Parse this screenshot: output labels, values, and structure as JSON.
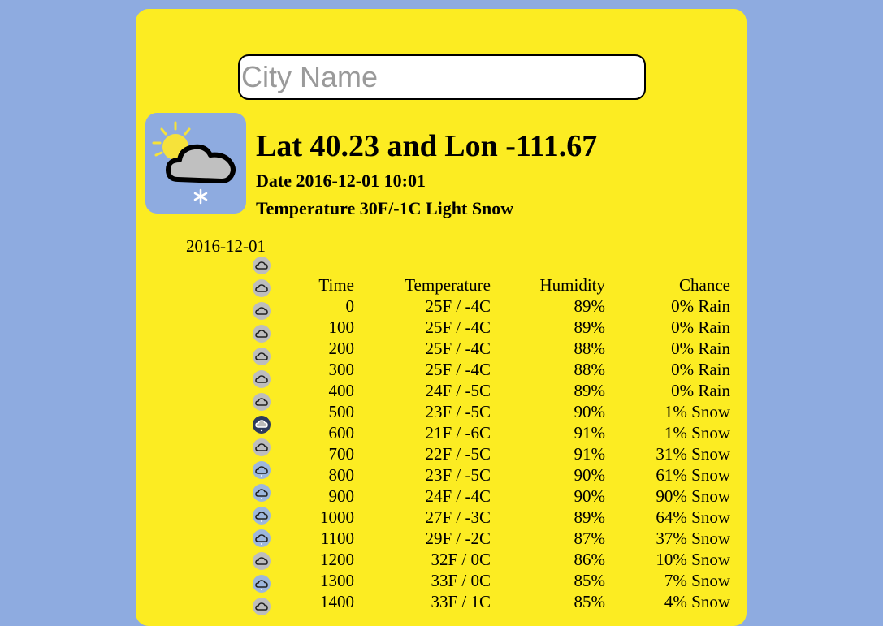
{
  "search": {
    "placeholder": "City Name"
  },
  "current": {
    "title": "Lat 40.23 and Lon -111.67",
    "date": "Date 2016-12-01 10:01",
    "temperature": "Temperature 30F/-1C Light Snow",
    "icon": "partly-sunny-snow-icon"
  },
  "forecast": {
    "day": "2016-12-01",
    "headers": {
      "time": "Time",
      "temperature": "Temperature",
      "humidity": "Humidity",
      "chance": "Chance"
    },
    "rows": [
      {
        "time": "0",
        "temperature": "25F / -4C",
        "humidity": "89%",
        "chance": "0% Rain",
        "icon": "cloud-icon"
      },
      {
        "time": "100",
        "temperature": "25F / -4C",
        "humidity": "89%",
        "chance": "0% Rain",
        "icon": "cloud-icon"
      },
      {
        "time": "200",
        "temperature": "25F / -4C",
        "humidity": "88%",
        "chance": "0% Rain",
        "icon": "cloud-icon"
      },
      {
        "time": "300",
        "temperature": "25F / -4C",
        "humidity": "88%",
        "chance": "0% Rain",
        "icon": "cloud-icon"
      },
      {
        "time": "400",
        "temperature": "24F / -5C",
        "humidity": "89%",
        "chance": "0% Rain",
        "icon": "cloud-icon"
      },
      {
        "time": "500",
        "temperature": "23F / -5C",
        "humidity": "90%",
        "chance": "1% Snow",
        "icon": "cloud-icon"
      },
      {
        "time": "600",
        "temperature": "21F / -6C",
        "humidity": "91%",
        "chance": "1% Snow",
        "icon": "night-snow-icon"
      },
      {
        "time": "700",
        "temperature": "22F / -5C",
        "humidity": "91%",
        "chance": "31% Snow",
        "icon": "cloud-icon"
      },
      {
        "time": "800",
        "temperature": "23F / -5C",
        "humidity": "90%",
        "chance": "61% Snow",
        "icon": "snow-cloud-icon"
      },
      {
        "time": "900",
        "temperature": "24F / -4C",
        "humidity": "90%",
        "chance": "90% Snow",
        "icon": "snow-cloud-icon"
      },
      {
        "time": "1000",
        "temperature": "27F / -3C",
        "humidity": "89%",
        "chance": "64% Snow",
        "icon": "snow-cloud-icon"
      },
      {
        "time": "1100",
        "temperature": "29F / -2C",
        "humidity": "87%",
        "chance": "37% Snow",
        "icon": "snow-cloud-icon"
      },
      {
        "time": "1200",
        "temperature": "32F / 0C",
        "humidity": "86%",
        "chance": "10% Snow",
        "icon": "cloud-icon"
      },
      {
        "time": "1300",
        "temperature": "33F / 0C",
        "humidity": "85%",
        "chance": "7% Snow",
        "icon": "snow-cloud-icon"
      },
      {
        "time": "1400",
        "temperature": "33F / 1C",
        "humidity": "85%",
        "chance": "4% Snow",
        "icon": "cloud-icon"
      }
    ]
  },
  "colors": {
    "page_bg": "#8eabe0",
    "card_bg": "#fcec22",
    "text": "#000000"
  }
}
